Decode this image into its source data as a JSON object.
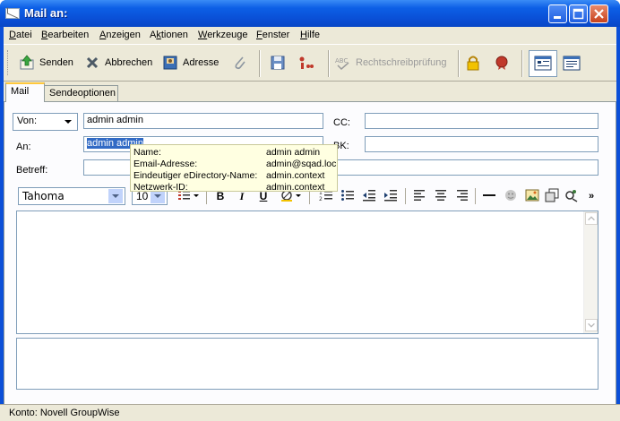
{
  "window": {
    "title": "Mail an:"
  },
  "menu": [
    {
      "label": "Datei",
      "u": "D"
    },
    {
      "label": "Bearbeiten",
      "u": "B"
    },
    {
      "label": "Anzeigen",
      "u": "A"
    },
    {
      "label": "Aktionen",
      "u": "k"
    },
    {
      "label": "Werkzeuge",
      "u": "W"
    },
    {
      "label": "Fenster",
      "u": "F"
    },
    {
      "label": "Hilfe",
      "u": "H"
    }
  ],
  "toolbar": {
    "send_label": "Senden",
    "cancel_label": "Abbrechen",
    "address_label": "Adresse",
    "spell_label": "Rechtschreibprüfung"
  },
  "tabs": [
    "Mail",
    "Sendeoptionen"
  ],
  "form": {
    "from_label": "Von:",
    "from_value": "admin admin",
    "to_label": "An:",
    "to_value": "admin admin",
    "cc_label": "CC:",
    "bc_label": "BK:",
    "subject_label": "Betreff:"
  },
  "format": {
    "font_name": "Tahoma",
    "font_size": "10"
  },
  "tooltip": {
    "rows": [
      {
        "label": "Name:",
        "value": "admin admin"
      },
      {
        "label": "Email-Adresse:",
        "value": "admin@sqad.loc"
      },
      {
        "label": "Eindeutiger eDirectory-Name:",
        "value": "admin.context"
      },
      {
        "label": "Netzwerk-ID:",
        "value": "admin.context"
      }
    ]
  },
  "status": {
    "text": "Konto: Novell GroupWise"
  },
  "colors": {
    "titlebar": "#0a4fd6",
    "selection": "#316ac5",
    "tooltip_bg": "#ffffe1"
  }
}
